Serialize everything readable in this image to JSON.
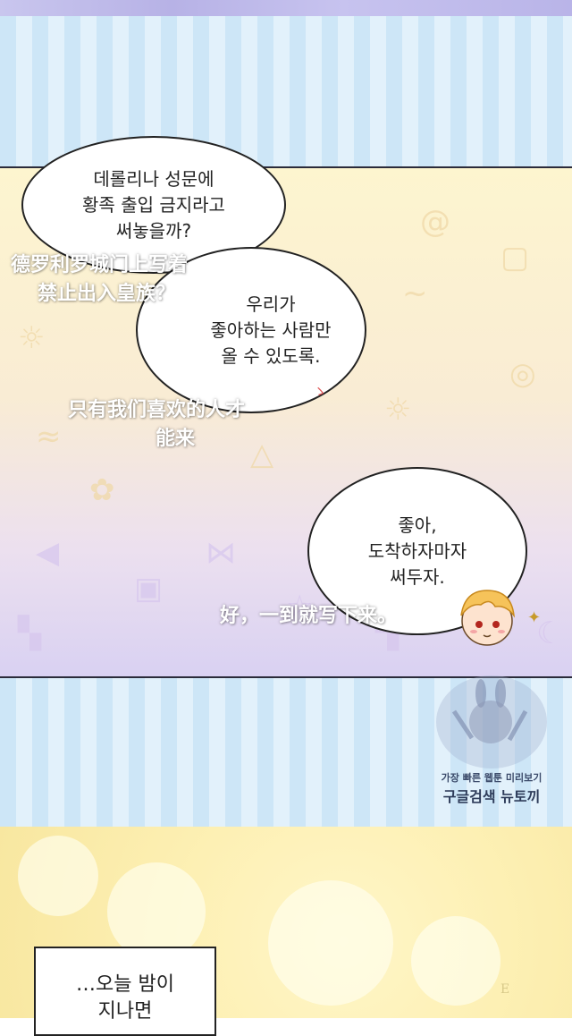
{
  "bubbles": {
    "b1": [
      "데롤리나 성문에",
      "황족 출입 금지라고",
      "써놓을까?"
    ],
    "b2": [
      "우리가",
      "좋아하는 사람만",
      "올 수 있도록."
    ],
    "b3": [
      "좋아,",
      "도착하자마자",
      "써두자."
    ]
  },
  "translations": {
    "t1": [
      "德罗利罗城门上写着",
      "禁止出入皇族？"
    ],
    "t2": [
      "只有我们喜欢的人才",
      "能来"
    ],
    "t3": "好，一到就写下来。"
  },
  "caption_box": [
    "…오늘 밤이",
    "지나면"
  ],
  "watermark": {
    "line1": "가장 빠른 웹툰 미리보기",
    "line2": "구글검색 뉴토끼",
    "corner": "E"
  },
  "colors": {
    "stripe_light": "#e2f1fb",
    "stripe_dark": "#cde6f7",
    "panel_top": "#fdf5cf",
    "panel_bottom": "#d9d1f2",
    "outline": "#222222"
  }
}
